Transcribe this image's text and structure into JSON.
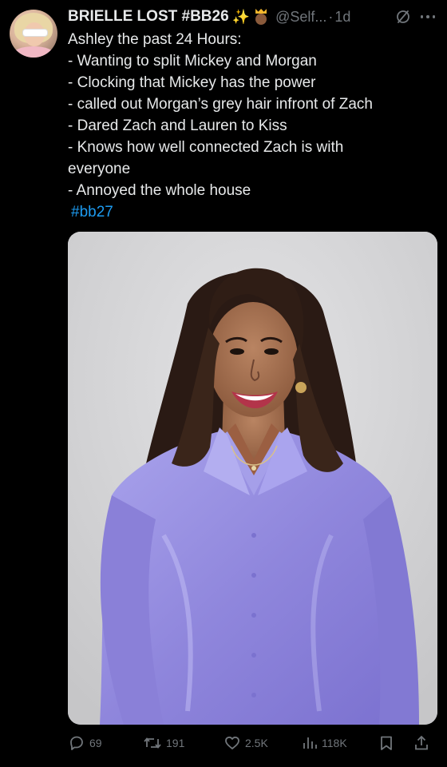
{
  "tweet": {
    "display_name": "BRIELLE LOST #BB26",
    "emojis": [
      "sparkles-emoji",
      "princess-emoji"
    ],
    "handle": "@Self...",
    "separator": "·",
    "time": "1d",
    "text_lines": [
      "Ashley the past 24 Hours:",
      "- Wanting to split Mickey and Morgan",
      "- Clocking that Mickey has the power",
      "- called out Morgan’s grey hair infront of Zach",
      "- Dared Zach and Lauren to Kiss",
      "- Knows how well connected Zach is with",
      "everyone",
      "- Annoyed the whole house"
    ],
    "hashtag": "#bb27"
  },
  "actions": {
    "replies": "69",
    "reposts": "191",
    "likes": "2.5K",
    "views": "118K"
  },
  "colors": {
    "background": "#000000",
    "text": "#e7e9ea",
    "secondary": "#71767b",
    "link": "#1d9bf0",
    "shirt": "#9b93e0"
  }
}
